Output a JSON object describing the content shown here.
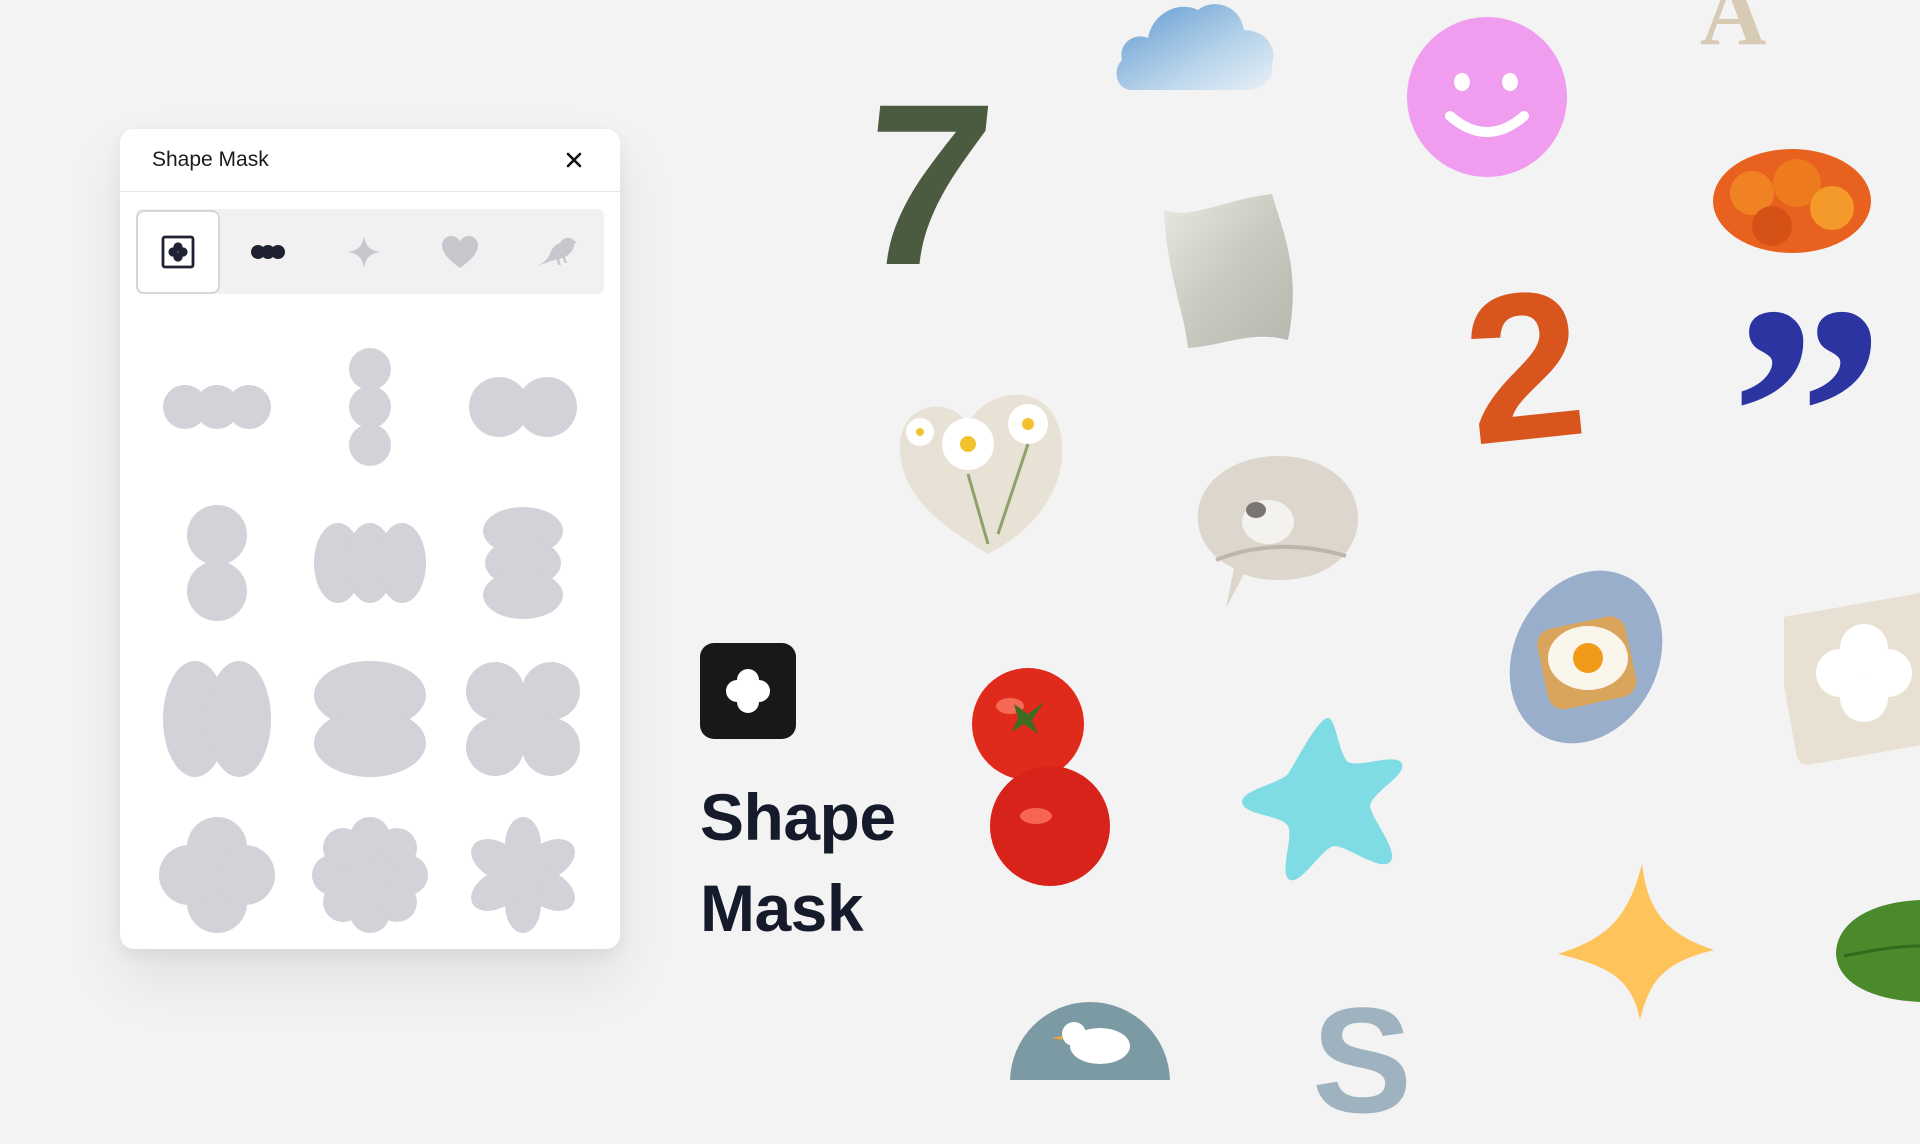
{
  "panel": {
    "title": "Shape Mask",
    "tabs": [
      {
        "icon": "shape-mask-icon",
        "active": true
      },
      {
        "icon": "three-dots-shape-icon",
        "active": false
      },
      {
        "icon": "sparkle-icon",
        "active": false
      },
      {
        "icon": "heart-icon",
        "active": false
      },
      {
        "icon": "bird-icon",
        "active": false
      }
    ],
    "shapes": [
      "three-circles-horizontal",
      "three-circles-vertical",
      "two-circles-horizontal",
      "two-circles-vertical",
      "three-blobs-horizontal",
      "stacked-blobs",
      "two-ovals-horizontal",
      "two-ovals-vertical",
      "four-circles-x",
      "four-leaf-clover",
      "scalloped-flower",
      "six-petal-flower"
    ]
  },
  "brand": {
    "line1": "Shape",
    "line2": "Mask"
  },
  "decorations": {
    "seven": "7",
    "two": "2",
    "letter_a": "A",
    "letter_s": "S",
    "quote": "”"
  },
  "colors": {
    "shape_gray": "#d1d3d9",
    "icon_dark": "#1e2233",
    "icon_gray": "#c6c8ce",
    "logo_bg": "#1a1816",
    "smiley": "#f09cef",
    "star_cyan": "#7fdce4",
    "sparkle_yellow": "#ffc35c",
    "quote_blue": "#2b34a1"
  }
}
